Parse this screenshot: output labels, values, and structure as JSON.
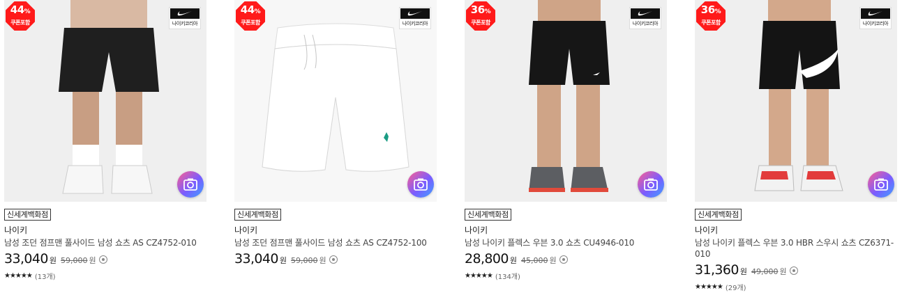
{
  "products": [
    {
      "discount": "44",
      "discount_unit": "%",
      "coupon": "쿠폰포함",
      "brand_logo_text": "나이키코리아",
      "store": "신세계백화점",
      "brand": "나이키",
      "title": "남성 조던 점프맨 풀사이드 남성 쇼츠 AS CZ4752-010",
      "price": "33,040",
      "price_unit": "원",
      "original_price": "59,000",
      "original_unit": "원",
      "stars": "★★★★★",
      "reviews": "(13개)",
      "rating": 5
    },
    {
      "discount": "44",
      "discount_unit": "%",
      "coupon": "쿠폰포함",
      "brand_logo_text": "나이키코리아",
      "store": "신세계백화점",
      "brand": "나이키",
      "title": "남성 조던 점프맨 풀사이드 남성 쇼츠 AS CZ4752-100",
      "price": "33,040",
      "price_unit": "원",
      "original_price": "59,000",
      "original_unit": "원"
    },
    {
      "discount": "36",
      "discount_unit": "%",
      "coupon": "쿠폰포함",
      "brand_logo_text": "나이키코리아",
      "store": "신세계백화점",
      "brand": "나이키",
      "title": "남성 나이키 플렉스 우븐 3.0 쇼츠 CU4946-010",
      "price": "28,800",
      "price_unit": "원",
      "original_price": "45,000",
      "original_unit": "원",
      "stars": "★★★★★",
      "reviews": "(134개)",
      "rating": 4.5
    },
    {
      "discount": "36",
      "discount_unit": "%",
      "coupon": "쿠폰포함",
      "brand_logo_text": "나이키코리아",
      "store": "신세계백화점",
      "brand": "나이키",
      "title": "남성 나이키 플렉스 우븐 3.0 HBR 스우시 쇼츠 CZ6371-010",
      "price": "31,360",
      "price_unit": "원",
      "original_price": "49,000",
      "original_unit": "원",
      "stars": "★★★★★",
      "reviews": "(29개)",
      "rating": 4.5
    }
  ],
  "colors": {
    "badge": "#ff1a1a",
    "camera_gradient": [
      "#ff5f8f",
      "#7a5cff",
      "#3fa1ff"
    ]
  },
  "icons": {
    "brand_logo": "nike-swoosh-icon",
    "similar_search": "camera-icon",
    "price_info": "info-icon"
  }
}
